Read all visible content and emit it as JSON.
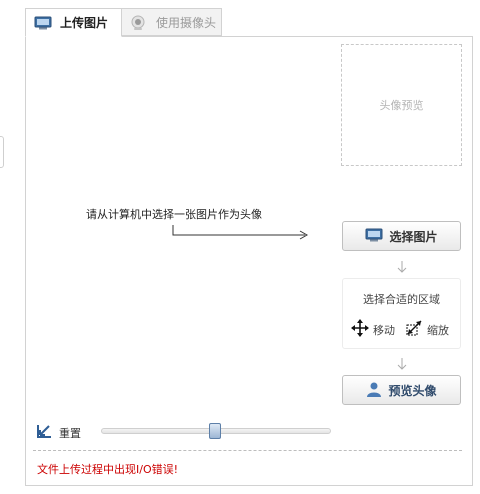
{
  "tabs": {
    "upload_label": "上传图片",
    "camera_label": "使用摄像头"
  },
  "preview": {
    "placeholder": "头像预览"
  },
  "hint": {
    "text": "请从计算机中选择一张图片作为头像"
  },
  "buttons": {
    "choose_label": "选择图片",
    "preview_label": "预览头像"
  },
  "region": {
    "title": "选择合适的区域",
    "move_label": "移动",
    "scale_label": "缩放"
  },
  "reset": {
    "label": "重置"
  },
  "zoom": {
    "level": 0.5
  },
  "status": {
    "error": "文件上传过程中出现I/O错误!"
  },
  "colors": {
    "error": "#cc0000",
    "border": "#d2d2d2"
  },
  "icons": {
    "upload": "monitor-icon",
    "camera": "webcam-icon",
    "choose": "monitor-icon",
    "preview": "user-icon",
    "move": "move-arrows-icon",
    "scale": "resize-icon",
    "reset": "reset-icon"
  }
}
